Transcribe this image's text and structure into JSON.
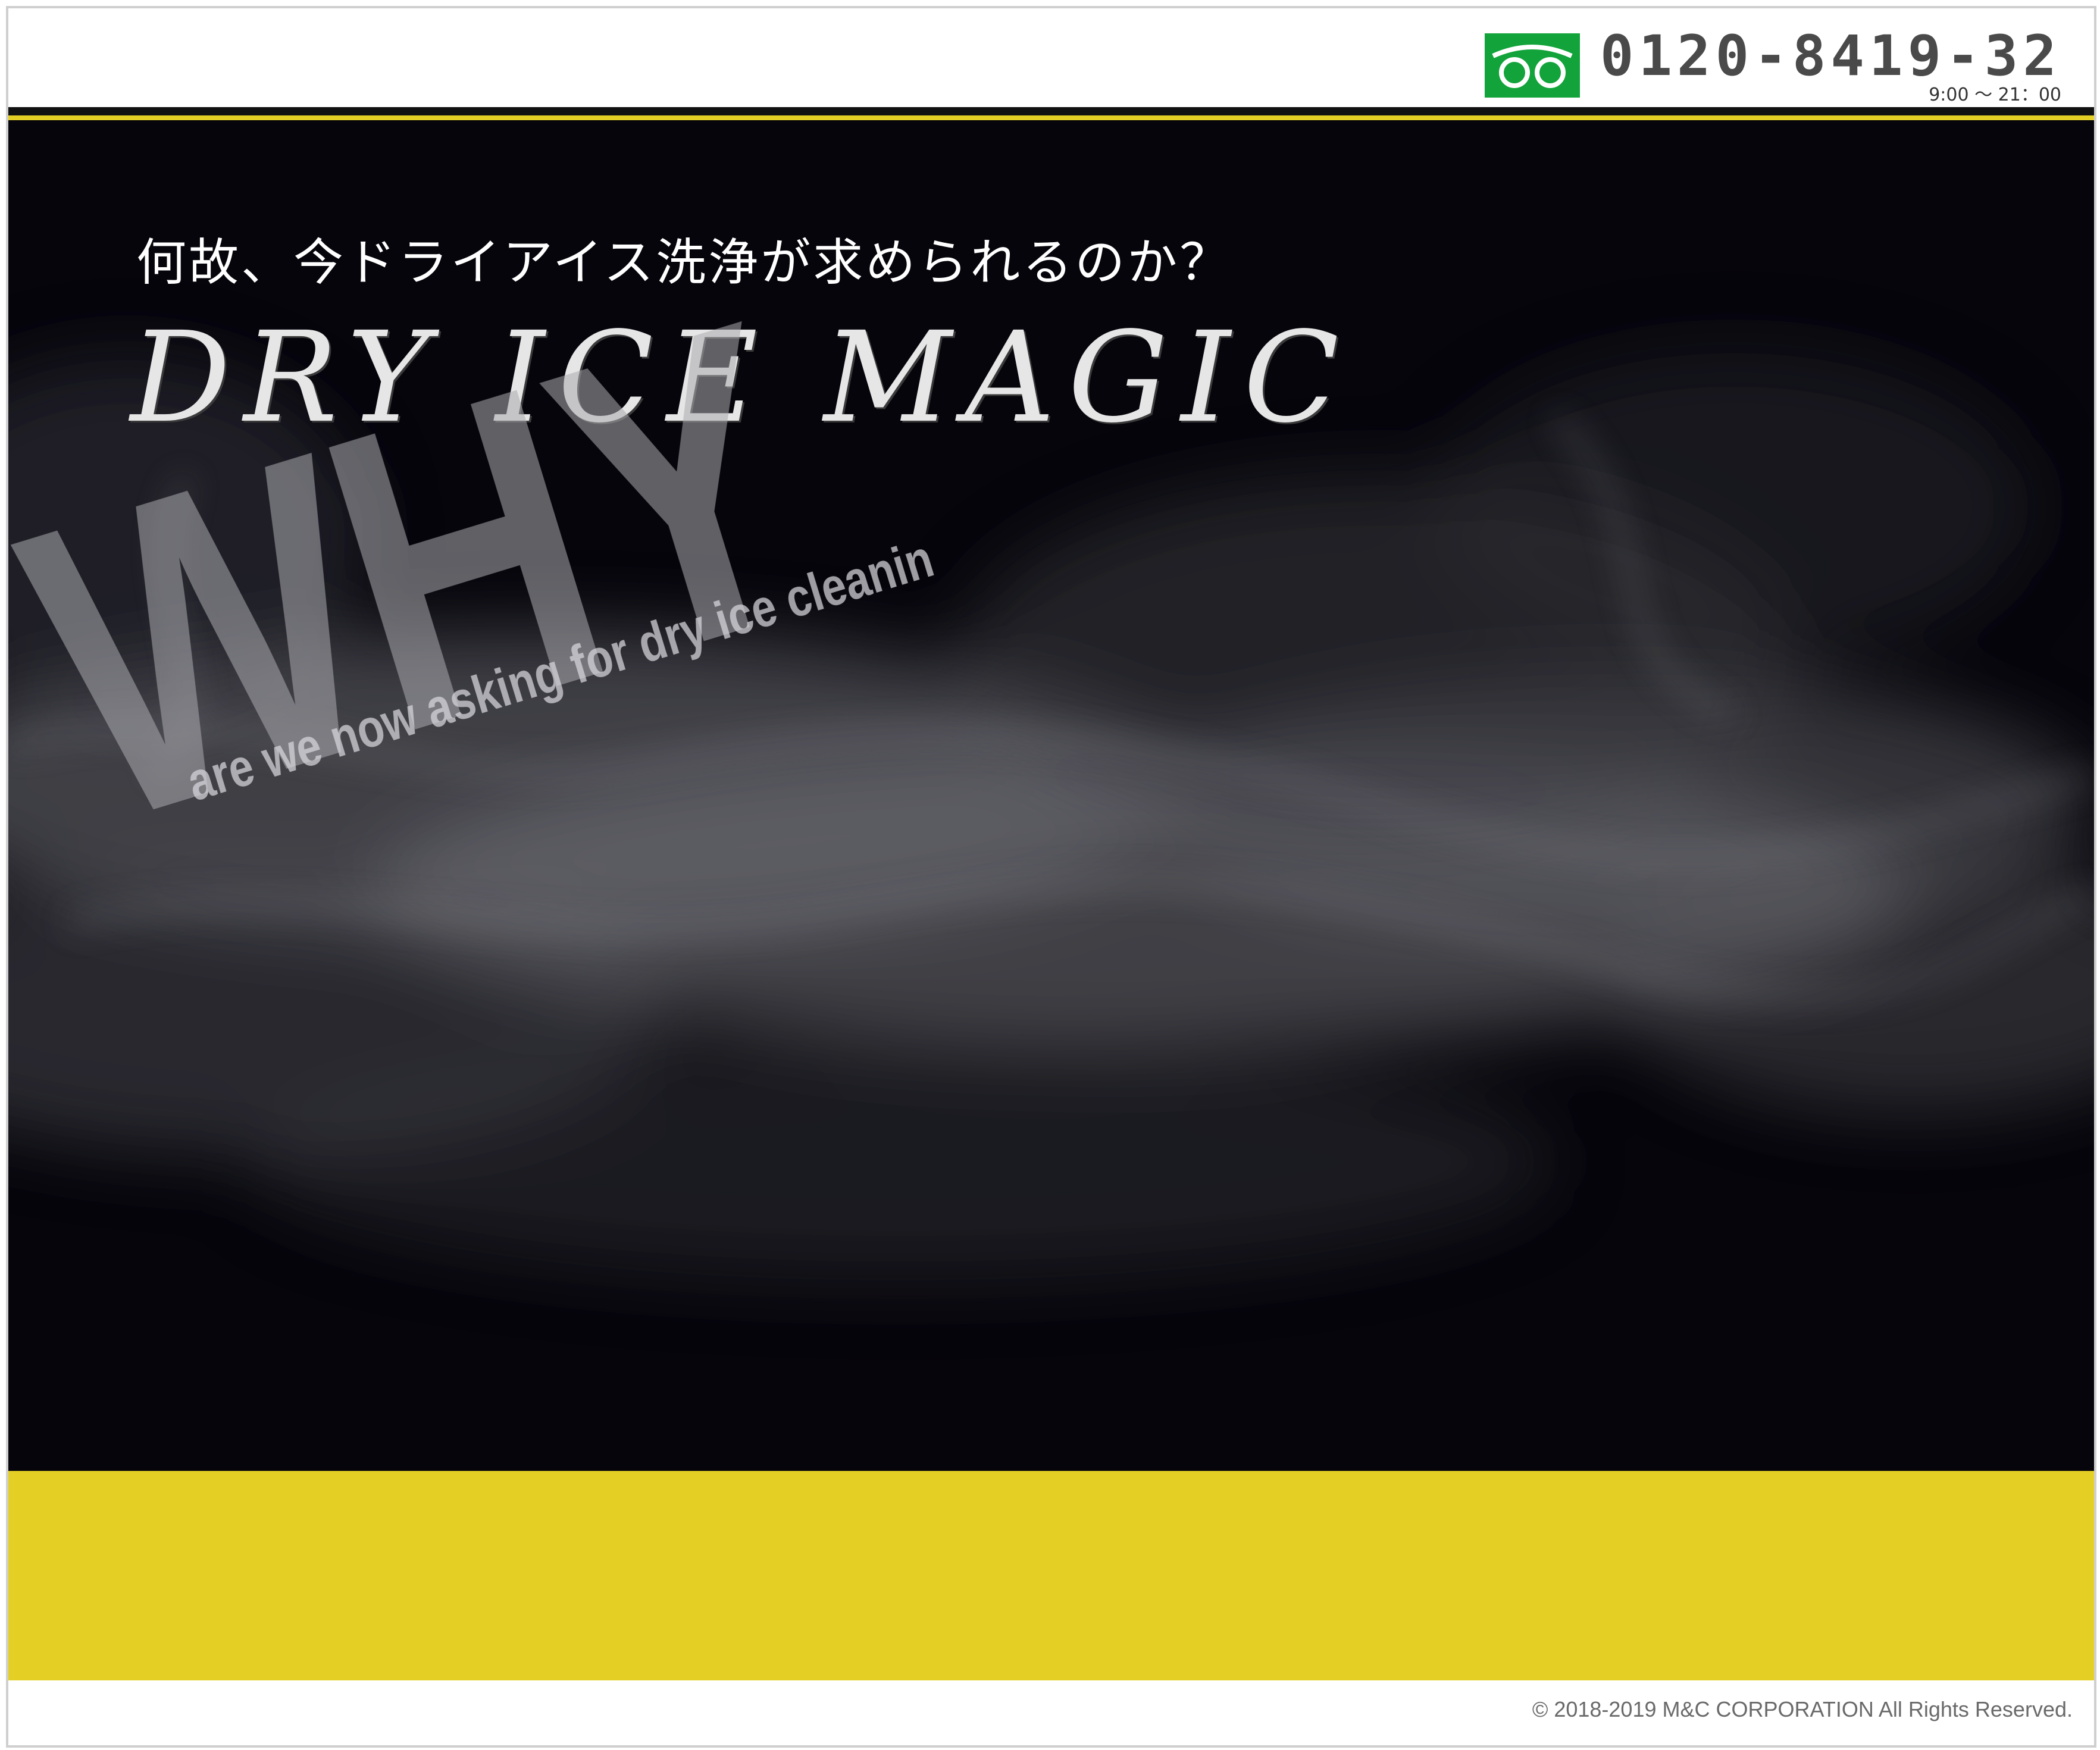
{
  "header": {
    "phone_icon": "freedial-icon",
    "phone_number": "0120-8419-32",
    "hours": "9:00 ～ 21：00"
  },
  "hero": {
    "jp_heading": "何故、今ドライアイス洗浄が求められるのか？",
    "brand_title": "DRY ICE MAGIC",
    "why_word": "WHY",
    "why_subtitle": "are we now asking for dry ice cleanin"
  },
  "footer": {
    "copyright": "© 2018-2019 M&C CORPORATION All Rights Reserved."
  },
  "colors": {
    "accent_yellow": "#e4d025",
    "freedial_green": "#12a33a",
    "hero_background": "#06050b"
  }
}
